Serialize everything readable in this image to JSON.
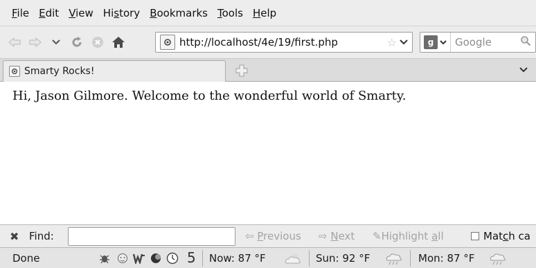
{
  "menu": [
    {
      "label": "File",
      "accel": "F",
      "rest": "ile"
    },
    {
      "label": "Edit",
      "accel": "E",
      "rest": "dit"
    },
    {
      "label": "View",
      "accel": "V",
      "rest": "iew"
    },
    {
      "label": "History",
      "pre": "Hi",
      "accel": "s",
      "rest": "tory"
    },
    {
      "label": "Bookmarks",
      "accel": "B",
      "rest": "ookmarks"
    },
    {
      "label": "Tools",
      "accel": "T",
      "rest": "ools"
    },
    {
      "label": "Help",
      "accel": "H",
      "rest": "elp"
    }
  ],
  "navbar": {
    "url": "http://localhost/4e/19/first.php",
    "search_placeholder": "Google"
  },
  "tab": {
    "title": "Smarty Rocks!"
  },
  "content": {
    "greeting": "Hi, Jason Gilmore. Welcome to the wonderful world of Smarty."
  },
  "findbar": {
    "label": "Find:",
    "value": "",
    "previous": {
      "accel": "P",
      "rest": "revious"
    },
    "next": {
      "accel": "N",
      "rest": "ext"
    },
    "highlight": {
      "pre": "Highlight ",
      "accel": "a",
      "rest": "ll"
    },
    "matchcase": {
      "pre": "Mat",
      "accel": "c",
      "rest": "h ca"
    }
  },
  "statusbar": {
    "status": "Done",
    "count": "5",
    "weather_now": "Now: 87 °F",
    "weather_sun": "Sun: 92 °F",
    "weather_mon": "Mon: 87 °F"
  },
  "colors": {
    "chrome": "#ececec",
    "text": "#1a1a1a",
    "disabled": "#a3a3a3"
  }
}
